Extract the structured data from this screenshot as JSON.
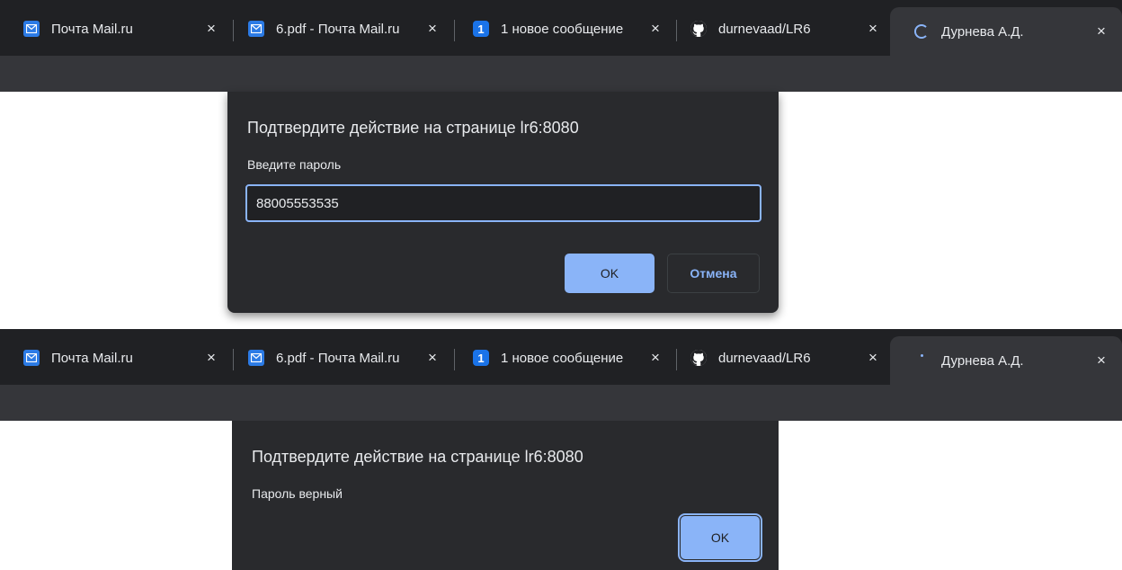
{
  "tabs": [
    {
      "title": "Почта Mail.ru",
      "icon": "mail-icon"
    },
    {
      "title": "6.pdf - Почта Mail.ru",
      "icon": "mail-icon"
    },
    {
      "title": "1 новое сообщение",
      "icon": "notification-badge-icon",
      "badge": "1"
    },
    {
      "title": "durnevaad/LR6",
      "icon": "github-icon"
    },
    {
      "title": "Дурнева А.Д.",
      "icon": "loading-spinner-icon",
      "active": true
    }
  ],
  "close_glyph": "×",
  "prompt_dialog": {
    "title": "Подтвердите действие на странице lr6:8080",
    "message": "Введите пароль",
    "input_value": "88005553535",
    "ok_label": "OK",
    "cancel_label": "Отмена"
  },
  "alert_dialog": {
    "title": "Подтвердите действие на странице lr6:8080",
    "message": "Пароль верный",
    "ok_label": "OK"
  },
  "colors": {
    "accent": "#8ab4f8",
    "dialog_bg": "#292a2d",
    "tabstrip_bg": "#202124"
  }
}
